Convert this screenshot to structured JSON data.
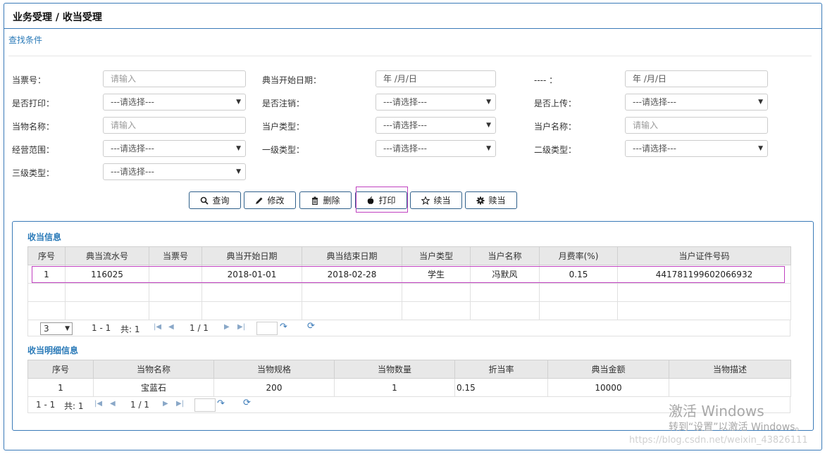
{
  "breadcrumb": "业务受理  /  收当受理",
  "search_section": "查找条件",
  "fields": {
    "ticket_no": {
      "label": "当票号：",
      "placeholder": "请输入"
    },
    "start_date": {
      "label": "典当开始日期：",
      "value": "年 /月/日"
    },
    "dash": {
      "label": "---- ：",
      "value": "年 /月/日"
    },
    "printed": {
      "label": "是否打印：",
      "value": "---请选择---"
    },
    "cancelled": {
      "label": "是否注销：",
      "value": "---请选择---"
    },
    "uploaded": {
      "label": "是否上传：",
      "value": "---请选择---"
    },
    "item_name": {
      "label": "当物名称：",
      "placeholder": "请输入"
    },
    "customer_type": {
      "label": "当户类型：",
      "value": "---请选择---"
    },
    "customer_name": {
      "label": "当户名称：",
      "placeholder": "请输入"
    },
    "scope": {
      "label": "经营范围：",
      "value": "---请选择---"
    },
    "level1": {
      "label": "一级类型：",
      "value": "---请选择---"
    },
    "level2": {
      "label": "二级类型：",
      "value": "---请选择---"
    },
    "level3": {
      "label": "三级类型：",
      "value": "---请选择---"
    }
  },
  "buttons": {
    "query": "查询",
    "edit": "修改",
    "delete": "删除",
    "print": "打印",
    "renew": "续当",
    "redeem": "赎当"
  },
  "pawn_info": {
    "title": "收当信息",
    "columns": [
      "序号",
      "典当流水号",
      "当票号",
      "典当开始日期",
      "典当结束日期",
      "当户类型",
      "当户名称",
      "月费率(%)",
      "当户证件号码"
    ],
    "rows": [
      [
        "1",
        "116025",
        "",
        "2018-01-01",
        "2018-02-28",
        "学生",
        "冯默风",
        "0.15",
        "441781199602066932"
      ]
    ],
    "pager": {
      "page_size": "3",
      "range": "1 - 1",
      "total": "共: 1",
      "page": "1 / 1"
    }
  },
  "detail_info": {
    "title": "收当明细信息",
    "columns": [
      "序号",
      "当物名称",
      "当物规格",
      "当物数量",
      "折当率",
      "典当金额",
      "当物描述"
    ],
    "rows": [
      [
        "1",
        "宝蓝石",
        "200",
        "1",
        "0.15",
        "10000",
        ""
      ]
    ],
    "pager": {
      "range": "1 - 1",
      "total": "共: 1",
      "page": "1 / 1"
    }
  },
  "watermark": {
    "line1": "激活 Windows",
    "line2": "转到“设置”以激活 Windows。",
    "url": "https://blog.csdn.net/weixin_43826111"
  },
  "icons": {
    "query": "search-icon",
    "edit": "pencil-icon",
    "delete": "trash-icon",
    "print": "apple-icon",
    "renew": "star-icon",
    "redeem": "gear-icon"
  }
}
